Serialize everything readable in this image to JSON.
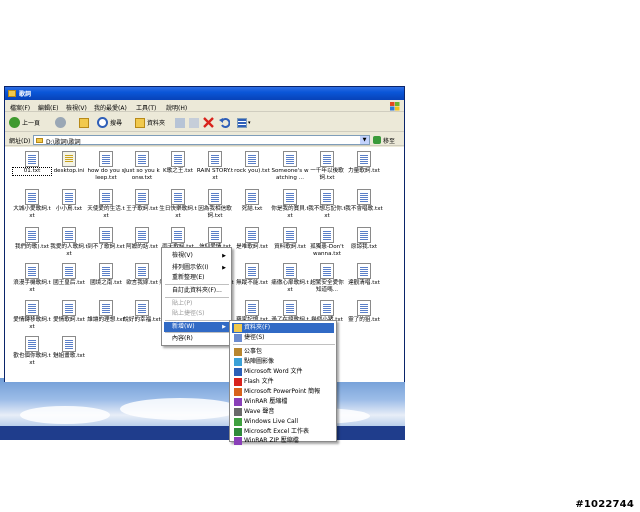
{
  "window": {
    "title": "歌詞",
    "menu": [
      "檔案(F)",
      "編輯(E)",
      "檢視(V)",
      "我的最愛(A)",
      "工具(T)",
      "說明(H)"
    ],
    "toolbar": {
      "back": "上一頁",
      "search": "搜尋",
      "folders": "資料夾"
    },
    "address": {
      "label": "網址(D)",
      "path": "D:\\歌詞\\歌詞",
      "go": "移至"
    }
  },
  "files": [
    {
      "name": "01.txt",
      "type": "txt",
      "selected": true
    },
    {
      "name": "desktop.ini",
      "type": "ini"
    },
    {
      "name": "how do you sleep.txt",
      "type": "txt"
    },
    {
      "name": "Just so you konw.txt",
      "type": "txt"
    },
    {
      "name": "K歌之王.txt",
      "type": "txt"
    },
    {
      "name": "RAIN STORY.txt",
      "type": "txt"
    },
    {
      "name": "rock you).txt",
      "type": "txt"
    },
    {
      "name": "Someone's watching ...",
      "type": "txt"
    },
    {
      "name": "一千年以後歌詞.txt",
      "type": "txt"
    },
    {
      "name": "力量歌詞.txt",
      "type": "txt"
    },
    {
      "name": "大城小愛歌詞.txt",
      "type": "txt"
    },
    {
      "name": "小小鳥.txt",
      "type": "txt"
    },
    {
      "name": "天使愛的生活.txt",
      "type": "txt"
    },
    {
      "name": "王子歌詞.txt",
      "type": "txt"
    },
    {
      "name": "生日快樂歌詞.txt",
      "type": "txt"
    },
    {
      "name": "因為我相信歌詞.txt",
      "type": "txt"
    },
    {
      "name": "死結.txt",
      "type": "txt"
    },
    {
      "name": "你是我的寶貝.txt",
      "type": "txt"
    },
    {
      "name": "我不想忘記你.txt",
      "type": "txt"
    },
    {
      "name": "我不會唱歌.txt",
      "type": "txt"
    },
    {
      "name": "我們的歌).txt",
      "type": "txt"
    },
    {
      "name": "我愛的人歌詞.txt",
      "type": "txt"
    },
    {
      "name": "到不了歌詞.txt",
      "type": "txt"
    },
    {
      "name": "阿嬤的話.txt",
      "type": "txt"
    },
    {
      "name": "雨天歌詞.txt",
      "type": "txt"
    },
    {
      "name": "信仰愛情.txt",
      "type": "txt"
    },
    {
      "name": "是唯歌詞.txt",
      "type": "txt"
    },
    {
      "name": "資料歌詞.txt",
      "type": "txt"
    },
    {
      "name": "孤獨患-Don't wanna.txt",
      "type": "txt"
    },
    {
      "name": "原諒我.txt",
      "type": "txt"
    },
    {
      "name": "浪漫手機歌詞.txt",
      "type": "txt"
    },
    {
      "name": "國王皇后.txt",
      "type": "txt"
    },
    {
      "name": "國境之南.txt",
      "type": "txt"
    },
    {
      "name": "欲言我嫁.txt",
      "type": "txt"
    },
    {
      "name": "然於說出口.txt",
      "type": "txt"
    },
    {
      "name": "最長的電影.txt",
      "type": "txt"
    },
    {
      "name": "無蹤不能.txt",
      "type": "txt"
    },
    {
      "name": "痛徹心扉歌詞.txt",
      "type": "txt"
    },
    {
      "name": "超驚安全愛你知道嗎...",
      "type": "txt"
    },
    {
      "name": "達觀清唱.txt",
      "type": "txt"
    },
    {
      "name": "愛情轉移歌詞.txt",
      "type": "txt"
    },
    {
      "name": "愛情歌詞.txt",
      "type": "txt"
    },
    {
      "name": "誰讓的理想.txt",
      "type": "txt"
    },
    {
      "name": "說好的幸福.txt",
      "type": "txt"
    },
    {
      "name": "蝸牛.txt",
      "type": "txt"
    },
    {
      "name": "撩風.txt",
      "type": "txt"
    },
    {
      "name": "羅家記憶.txt",
      "type": "txt"
    },
    {
      "name": "過了在總歌詞.txt",
      "type": "txt"
    },
    {
      "name": "幾個小猪.txt",
      "type": "txt"
    },
    {
      "name": "靈了的狙.txt",
      "type": "txt"
    },
    {
      "name": "歡也個你歌詞.txt",
      "type": "txt"
    },
    {
      "name": "魅姐畫歌.txt",
      "type": "txt"
    }
  ],
  "context_menu": {
    "items": [
      {
        "label": "檢視(V)",
        "arrow": true
      },
      {
        "label": "排列圖示依(I)",
        "arrow": true
      },
      {
        "label": "重新整理(E)"
      },
      {
        "label": "自訂此資料夾(F)..."
      },
      {
        "label": "貼上(P)",
        "disabled": true
      },
      {
        "label": "貼上捷徑(S)",
        "disabled": true
      },
      {
        "label": "新增(W)",
        "arrow": true,
        "highlighted": true
      },
      {
        "label": "內容(R)"
      }
    ]
  },
  "new_submenu": {
    "items": [
      {
        "label": "資料夾(F)",
        "icon": "folder-icon",
        "highlighted": true
      },
      {
        "label": "捷徑(S)",
        "icon": "shortcut-icon"
      },
      {
        "label": "公事包",
        "icon": "briefcase-icon"
      },
      {
        "label": "點陣圖影像",
        "icon": "bitmap-icon"
      },
      {
        "label": "Microsoft Word 文件",
        "icon": "word-icon"
      },
      {
        "label": "Flash 文件",
        "icon": "flash-icon"
      },
      {
        "label": "Microsoft PowerPoint 簡報",
        "icon": "powerpoint-icon"
      },
      {
        "label": "WinRAR 壓縮檔",
        "icon": "winrar-icon"
      },
      {
        "label": "Wave 聲音",
        "icon": "wave-icon"
      },
      {
        "label": "Windows Live Call",
        "icon": "live-call-icon"
      },
      {
        "label": "Microsoft Excel 工作表",
        "icon": "excel-icon"
      },
      {
        "label": "WinRAR ZIP 壓縮檔",
        "icon": "winrar-zip-icon"
      }
    ]
  },
  "colors": {
    "titlebar": "#0a56d8",
    "highlight": "#316ac5",
    "chrome": "#ece9d8"
  },
  "watermark": "#1022744"
}
